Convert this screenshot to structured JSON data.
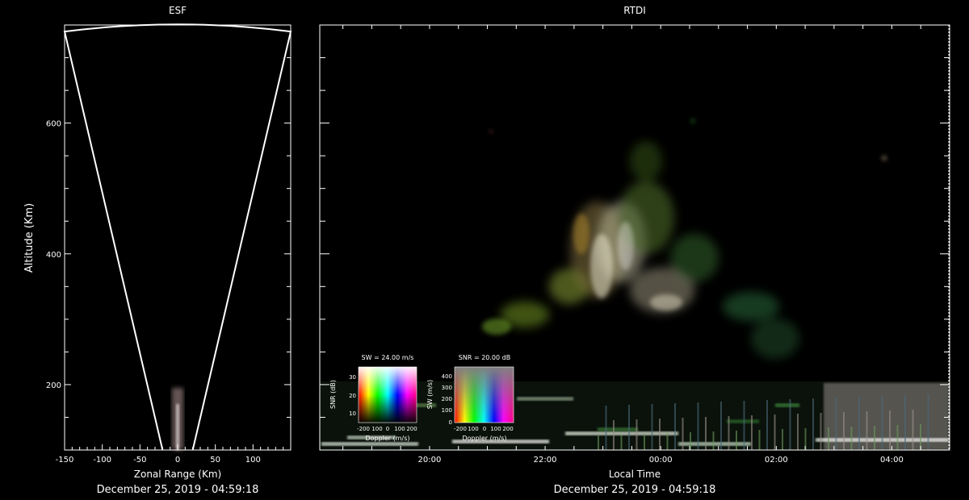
{
  "chart_data": [
    {
      "type": "scatter",
      "title": "ESF",
      "xlabel": "Zonal Range (Km)",
      "ylabel": "Altitude (Km)",
      "xlim": [
        -150,
        150
      ],
      "ylim": [
        100,
        750
      ],
      "x_ticks": [
        -150,
        -100,
        -50,
        0,
        50,
        100
      ],
      "y_ticks": [
        200,
        400,
        600
      ],
      "x_tick_labels": [
        "-150",
        "-100",
        "-50",
        "0",
        "50",
        "100"
      ],
      "y_tick_labels": [
        "200",
        "400",
        "600"
      ],
      "timestamp": "December 25, 2019 - 04:59:18",
      "fan_outline": {
        "x": [
          -20,
          -150,
          0,
          150,
          20
        ],
        "y": [
          100,
          740,
          752,
          740,
          100
        ]
      },
      "echo": {
        "x": [
          -12,
          12
        ],
        "y": [
          100,
          195
        ]
      }
    },
    {
      "type": "heatmap",
      "title": "RTDI",
      "xlabel": "Local Time",
      "ylabel": "",
      "x_tick_labels": [
        "20:00",
        "22:00",
        "00:00",
        "02:00",
        "04:00"
      ],
      "x_ticks_hours": [
        20,
        22,
        24,
        26,
        28
      ],
      "xlim_hours": [
        18.1,
        29.0
      ],
      "ylim": [
        100,
        750
      ],
      "y_ticks": [
        200,
        400,
        600
      ],
      "timestamp": "December 25, 2019 - 04:59:18",
      "echo_regions": [
        {
          "name": "plume",
          "t": [
            21.8,
            25.0
          ],
          "alt": [
            230,
            600
          ]
        },
        {
          "name": "bottomside",
          "t": [
            18.1,
            29.0
          ],
          "alt": [
            100,
            205
          ]
        }
      ]
    }
  ],
  "legends": {
    "sw": {
      "title": "SW = 24.00 m/s",
      "ylabel": "SNR (dB)",
      "xlabel": "Doppler (m/s)",
      "x_tick_labels": [
        "-200",
        "100",
        "0",
        "100",
        "200"
      ],
      "y_tick_labels": [
        "10",
        "20",
        "30"
      ]
    },
    "snr": {
      "title": "SNR = 20.00 dB",
      "ylabel": "SW (m/s)",
      "xlabel": "Doppler (m/s)",
      "x_tick_labels": [
        "-200",
        "100",
        "0",
        "100",
        "200"
      ],
      "y_tick_labels": [
        "0",
        "100",
        "200",
        "300",
        "400"
      ]
    }
  },
  "colors": {
    "background": "#000000",
    "axes": "#ffffff"
  }
}
